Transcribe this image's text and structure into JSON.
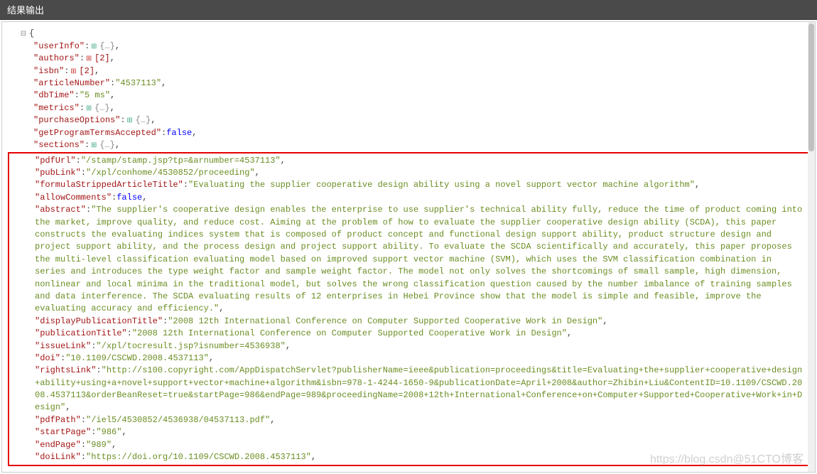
{
  "header": {
    "title": "结果输出"
  },
  "watermark": "https://blog.csdn@51CTO博客",
  "toggles": {
    "minus": "⊟",
    "plus_blue": "⊞",
    "plus_red": "⊞"
  },
  "collapsed": {
    "obj": "{…}",
    "arr2": "[2]"
  },
  "json": {
    "open": "{",
    "userInfo_key": "\"userInfo\"",
    "authors_key": "\"authors\"",
    "isbn_key": "\"isbn\"",
    "articleNumber_key": "\"articleNumber\"",
    "articleNumber_val": "\"4537113\"",
    "dbTime_key": "\"dbTime\"",
    "dbTime_val": "\"5 ms\"",
    "metrics_key": "\"metrics\"",
    "purchaseOptions_key": "\"purchaseOptions\"",
    "getProgramTermsAccepted_key": "\"getProgramTermsAccepted\"",
    "false_val": "false",
    "sections_key": "\"sections\"",
    "pdfUrl_key": "\"pdfUrl\"",
    "pdfUrl_val": "\"/stamp/stamp.jsp?tp=&arnumber=4537113\"",
    "pubLink_key": "\"pubLink\"",
    "pubLink_val": "\"/xpl/conhome/4530852/proceeding\"",
    "formulaStrippedArticleTitle_key": "\"formulaStrippedArticleTitle\"",
    "formulaStrippedArticleTitle_val": "\"Evaluating the supplier cooperative design ability using a novel support vector machine algorithm\"",
    "allowComments_key": "\"allowComments\"",
    "abstract_key": "\"abstract\"",
    "abstract_val": "\"The supplier's cooperative design enables the enterprise to use supplier's technical ability fully, reduce the time of product coming into the market, improve quality, and reduce cost. Aiming at the problem of how to evaluate the supplier cooperative design ability (SCDA), this paper constructs the evaluating indices system that is composed of product concept and functional design support ability, product structure design and project support ability, and the process design and project support ability. To evaluate the SCDA scientifically and accurately, this paper proposes the multi-level classification evaluating model based on improved support vector machine (SVM), which uses the SVM classification combination in series and introduces the type weight factor and sample weight factor. The model not only solves the shortcomings of small sample, high dimension, nonlinear and local minima in the traditional model, but solves the wrong classification question caused by the number imbalance of training samples and data interference. The SCDA evaluating results of 12 enterprises in Hebei Province show that the model is simple and feasible, improve the evaluating accuracy and efficiency.\"",
    "displayPublicationTitle_key": "\"displayPublicationTitle\"",
    "displayPublicationTitle_val": "\"2008 12th International Conference on Computer Supported Cooperative Work in Design\"",
    "publicationTitle_key": "\"publicationTitle\"",
    "publicationTitle_val": "\"2008 12th International Conference on Computer Supported Cooperative Work in Design\"",
    "issueLink_key": "\"issueLink\"",
    "issueLink_val": "\"/xpl/tocresult.jsp?isnumber=4536938\"",
    "doi_key": "\"doi\"",
    "doi_val": "\"10.1109/CSCWD.2008.4537113\"",
    "rightsLink_key": "\"rightsLink\"",
    "rightsLink_val": "\"http://s100.copyright.com/AppDispatchServlet?publisherName=ieee&publication=proceedings&title=Evaluating+the+supplier+cooperative+design+ability+using+a+novel+support+vector+machine+algorithm&isbn=978-1-4244-1650-9&publicationDate=April+2008&author=Zhibin+Liu&ContentID=10.1109/CSCWD.2008.4537113&orderBeanReset=true&startPage=986&endPage=989&proceedingName=2008+12th+International+Conference+on+Computer+Supported+Cooperative+Work+in+Design\"",
    "pdfPath_key": "\"pdfPath\"",
    "pdfPath_val": "\"/iel5/4530852/4536938/04537113.pdf\"",
    "startPage_key": "\"startPage\"",
    "startPage_val": "\"986\"",
    "endPage_key": "\"endPage\"",
    "endPage_val": "\"989\"",
    "doiLink_key": "\"doiLink\"",
    "doiLink_val": "\"https://doi.org/10.1109/CSCWD.2008.4537113\""
  }
}
